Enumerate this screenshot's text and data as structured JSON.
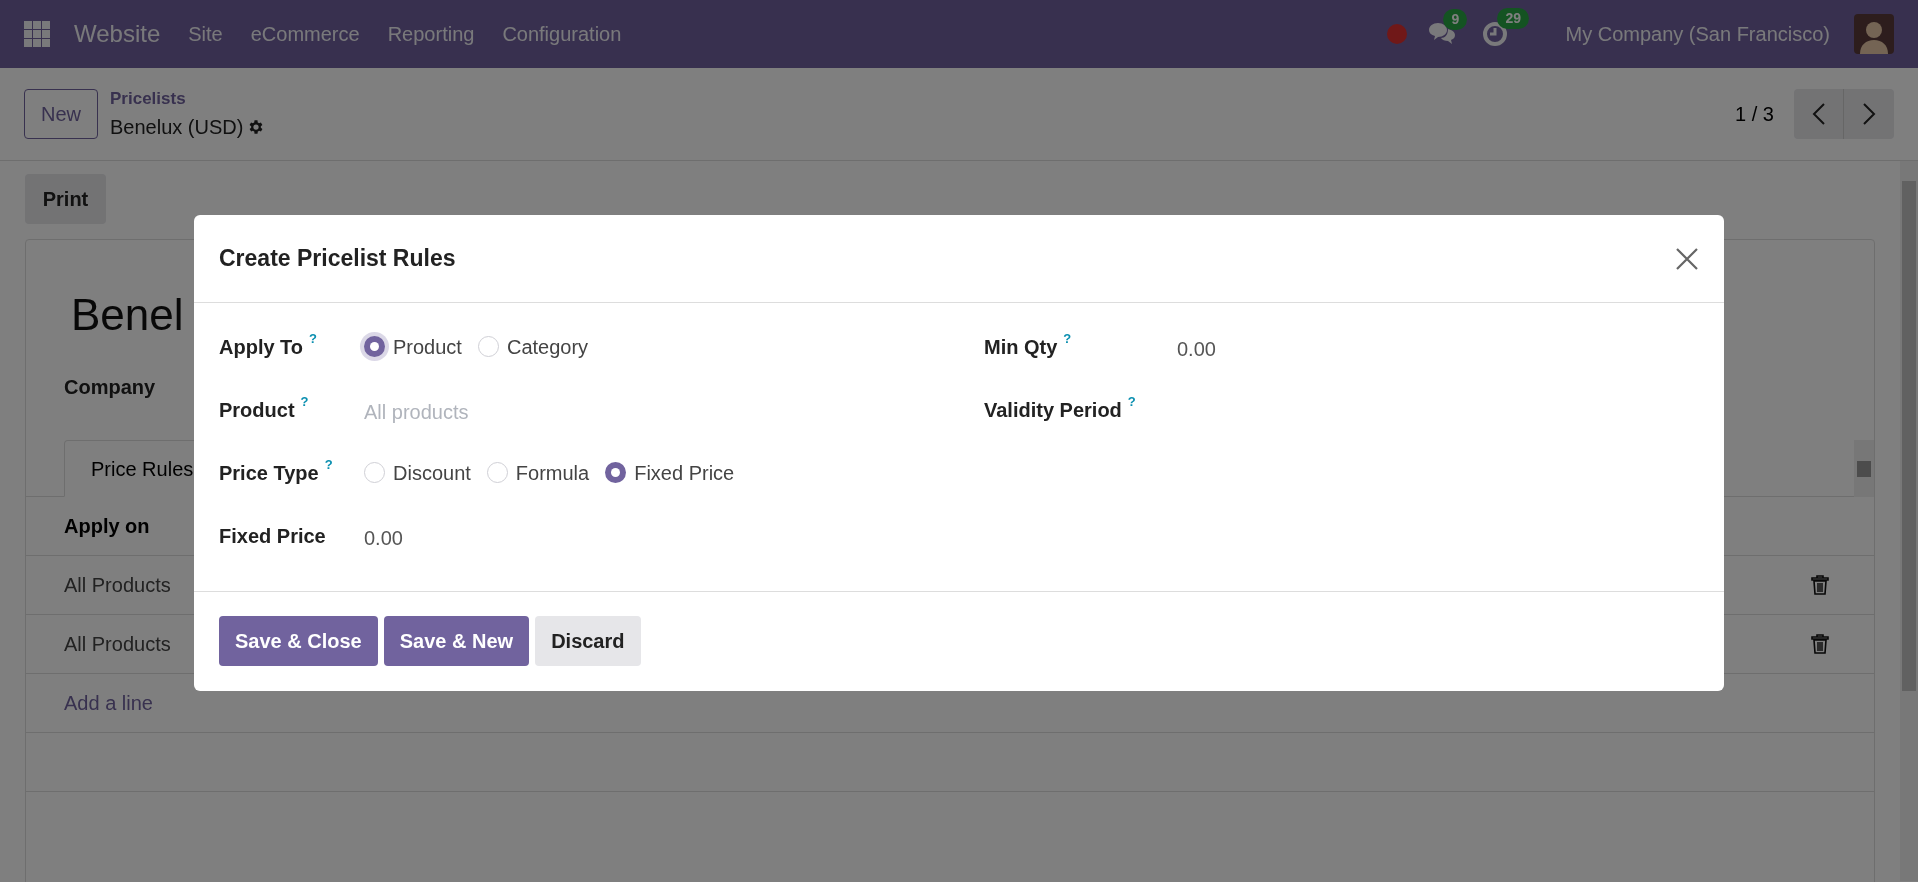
{
  "navbar": {
    "app": "Website",
    "menus": [
      "Site",
      "eCommerce",
      "Reporting",
      "Configuration"
    ],
    "messages_count": "9",
    "activities_count": "29",
    "company": "My Company (San Francisco)"
  },
  "control_panel": {
    "new_button": "New",
    "breadcrumb": "Pricelists",
    "record": "Benelux (USD)",
    "pager": "1 / 3"
  },
  "print_button": "Print",
  "form": {
    "title": "Benel",
    "company_label": "Company",
    "tabs": [
      {
        "label": "Price Rules",
        "selected": true
      }
    ],
    "table": {
      "columns": [
        "Apply on"
      ],
      "rows": [
        {
          "apply_on": "All Products"
        },
        {
          "apply_on": "All Products"
        }
      ],
      "add_line": "Add a line"
    }
  },
  "dialog": {
    "title": "Create Pricelist Rules",
    "left_fields": [
      {
        "kind": "radio",
        "label": "Apply To",
        "help": "?",
        "options": [
          {
            "label": "Product",
            "selected": true,
            "focused": true
          },
          {
            "label": "Category",
            "selected": false,
            "focused": false
          }
        ]
      },
      {
        "kind": "input",
        "label": "Product",
        "help": "?",
        "placeholder": "All products"
      },
      {
        "kind": "radio",
        "label": "Price Type",
        "help": "?",
        "options": [
          {
            "label": "Discount",
            "selected": false,
            "focused": false
          },
          {
            "label": "Formula",
            "selected": false,
            "focused": false
          },
          {
            "label": "Fixed Price",
            "selected": true,
            "focused": false
          }
        ]
      },
      {
        "kind": "input",
        "label": "Fixed Price",
        "value": "0.00"
      }
    ],
    "right_fields": [
      {
        "kind": "input",
        "label": "Min Qty",
        "help": "?",
        "value": "0.00"
      },
      {
        "kind": "input",
        "label": "Validity Period",
        "help": "?"
      }
    ],
    "buttons": [
      {
        "label": "Save & Close",
        "kind": "primary"
      },
      {
        "label": "Save & New",
        "kind": "primary"
      },
      {
        "label": "Discard",
        "kind": "secondary"
      }
    ]
  }
}
